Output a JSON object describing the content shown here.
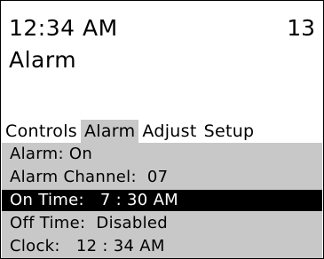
{
  "header": {
    "time": "12:34 AM",
    "channel": "13",
    "mode": "Alarm"
  },
  "tabs": [
    {
      "label": "Controls",
      "active": false
    },
    {
      "label": "Alarm",
      "active": true
    },
    {
      "label": "Adjust",
      "active": false
    },
    {
      "label": "Setup",
      "active": false
    }
  ],
  "menu": {
    "items": [
      {
        "label": "Alarm: On",
        "selected": false
      },
      {
        "label": "Alarm Channel:  07",
        "selected": false
      },
      {
        "label": "On Time:   7 : 30 AM",
        "selected": true
      },
      {
        "label": "Off Time:  Disabled",
        "selected": false
      },
      {
        "label": "Clock:   12 : 34 AM",
        "selected": false
      }
    ]
  },
  "colors": {
    "menu_background": "#c8c8c8",
    "selected_background": "#000000",
    "selected_text": "#ffffff"
  }
}
